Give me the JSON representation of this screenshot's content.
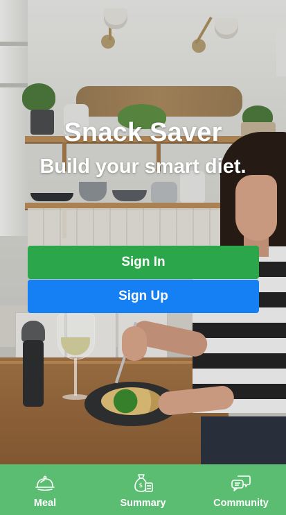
{
  "app": {
    "title": "Snack Saver",
    "tagline": "Build your smart diet."
  },
  "auth": {
    "sign_in_label": "Sign In",
    "sign_up_label": "Sign Up",
    "sign_in_color": "#2ca64b",
    "sign_up_color": "#1580f3"
  },
  "tabbar": {
    "background": "#5bbd72",
    "items": [
      {
        "label": "Meal",
        "icon": "cloche-icon"
      },
      {
        "label": "Summary",
        "icon": "money-bag-icon"
      },
      {
        "label": "Community",
        "icon": "chat-bubbles-icon"
      }
    ]
  }
}
